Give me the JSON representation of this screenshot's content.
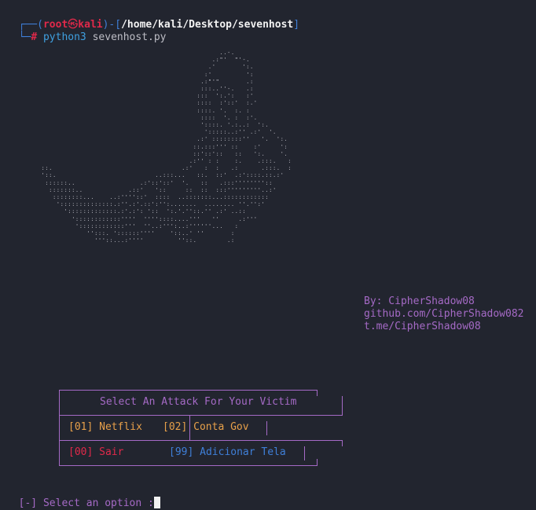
{
  "prompt": {
    "corner_top": "┌──",
    "open_paren": "(",
    "user": "root",
    "skull": "㉿",
    "host": "kali",
    "close_mid": ")-[",
    "path": "/home/kali/Desktop/sevenhost",
    "close_bracket": "]",
    "corner_bottom": "└─",
    "hash": "#",
    "command": "python3",
    "argument": "sevenhost.py"
  },
  "credits": {
    "by": "By: CipherShadow08",
    "github": "github.com/CipherShadow082",
    "telegram": "t.me/CipherShadow08"
  },
  "menu": {
    "title": "Select An Attack For Your Victim",
    "option_01": "[01] Netflix",
    "option_02": "[02] Conta Gov",
    "option_00": "[00] Sair",
    "option_99": "[99] Adicionar Tela"
  },
  "input": {
    "prompt": "[-] Select an option :"
  },
  "colors": {
    "background": "#22252f",
    "accent_purple": "#a56ac6",
    "prompt_blue": "#3f7fd8",
    "prompt_red": "#e0294a",
    "orange": "#e7a04a"
  }
}
